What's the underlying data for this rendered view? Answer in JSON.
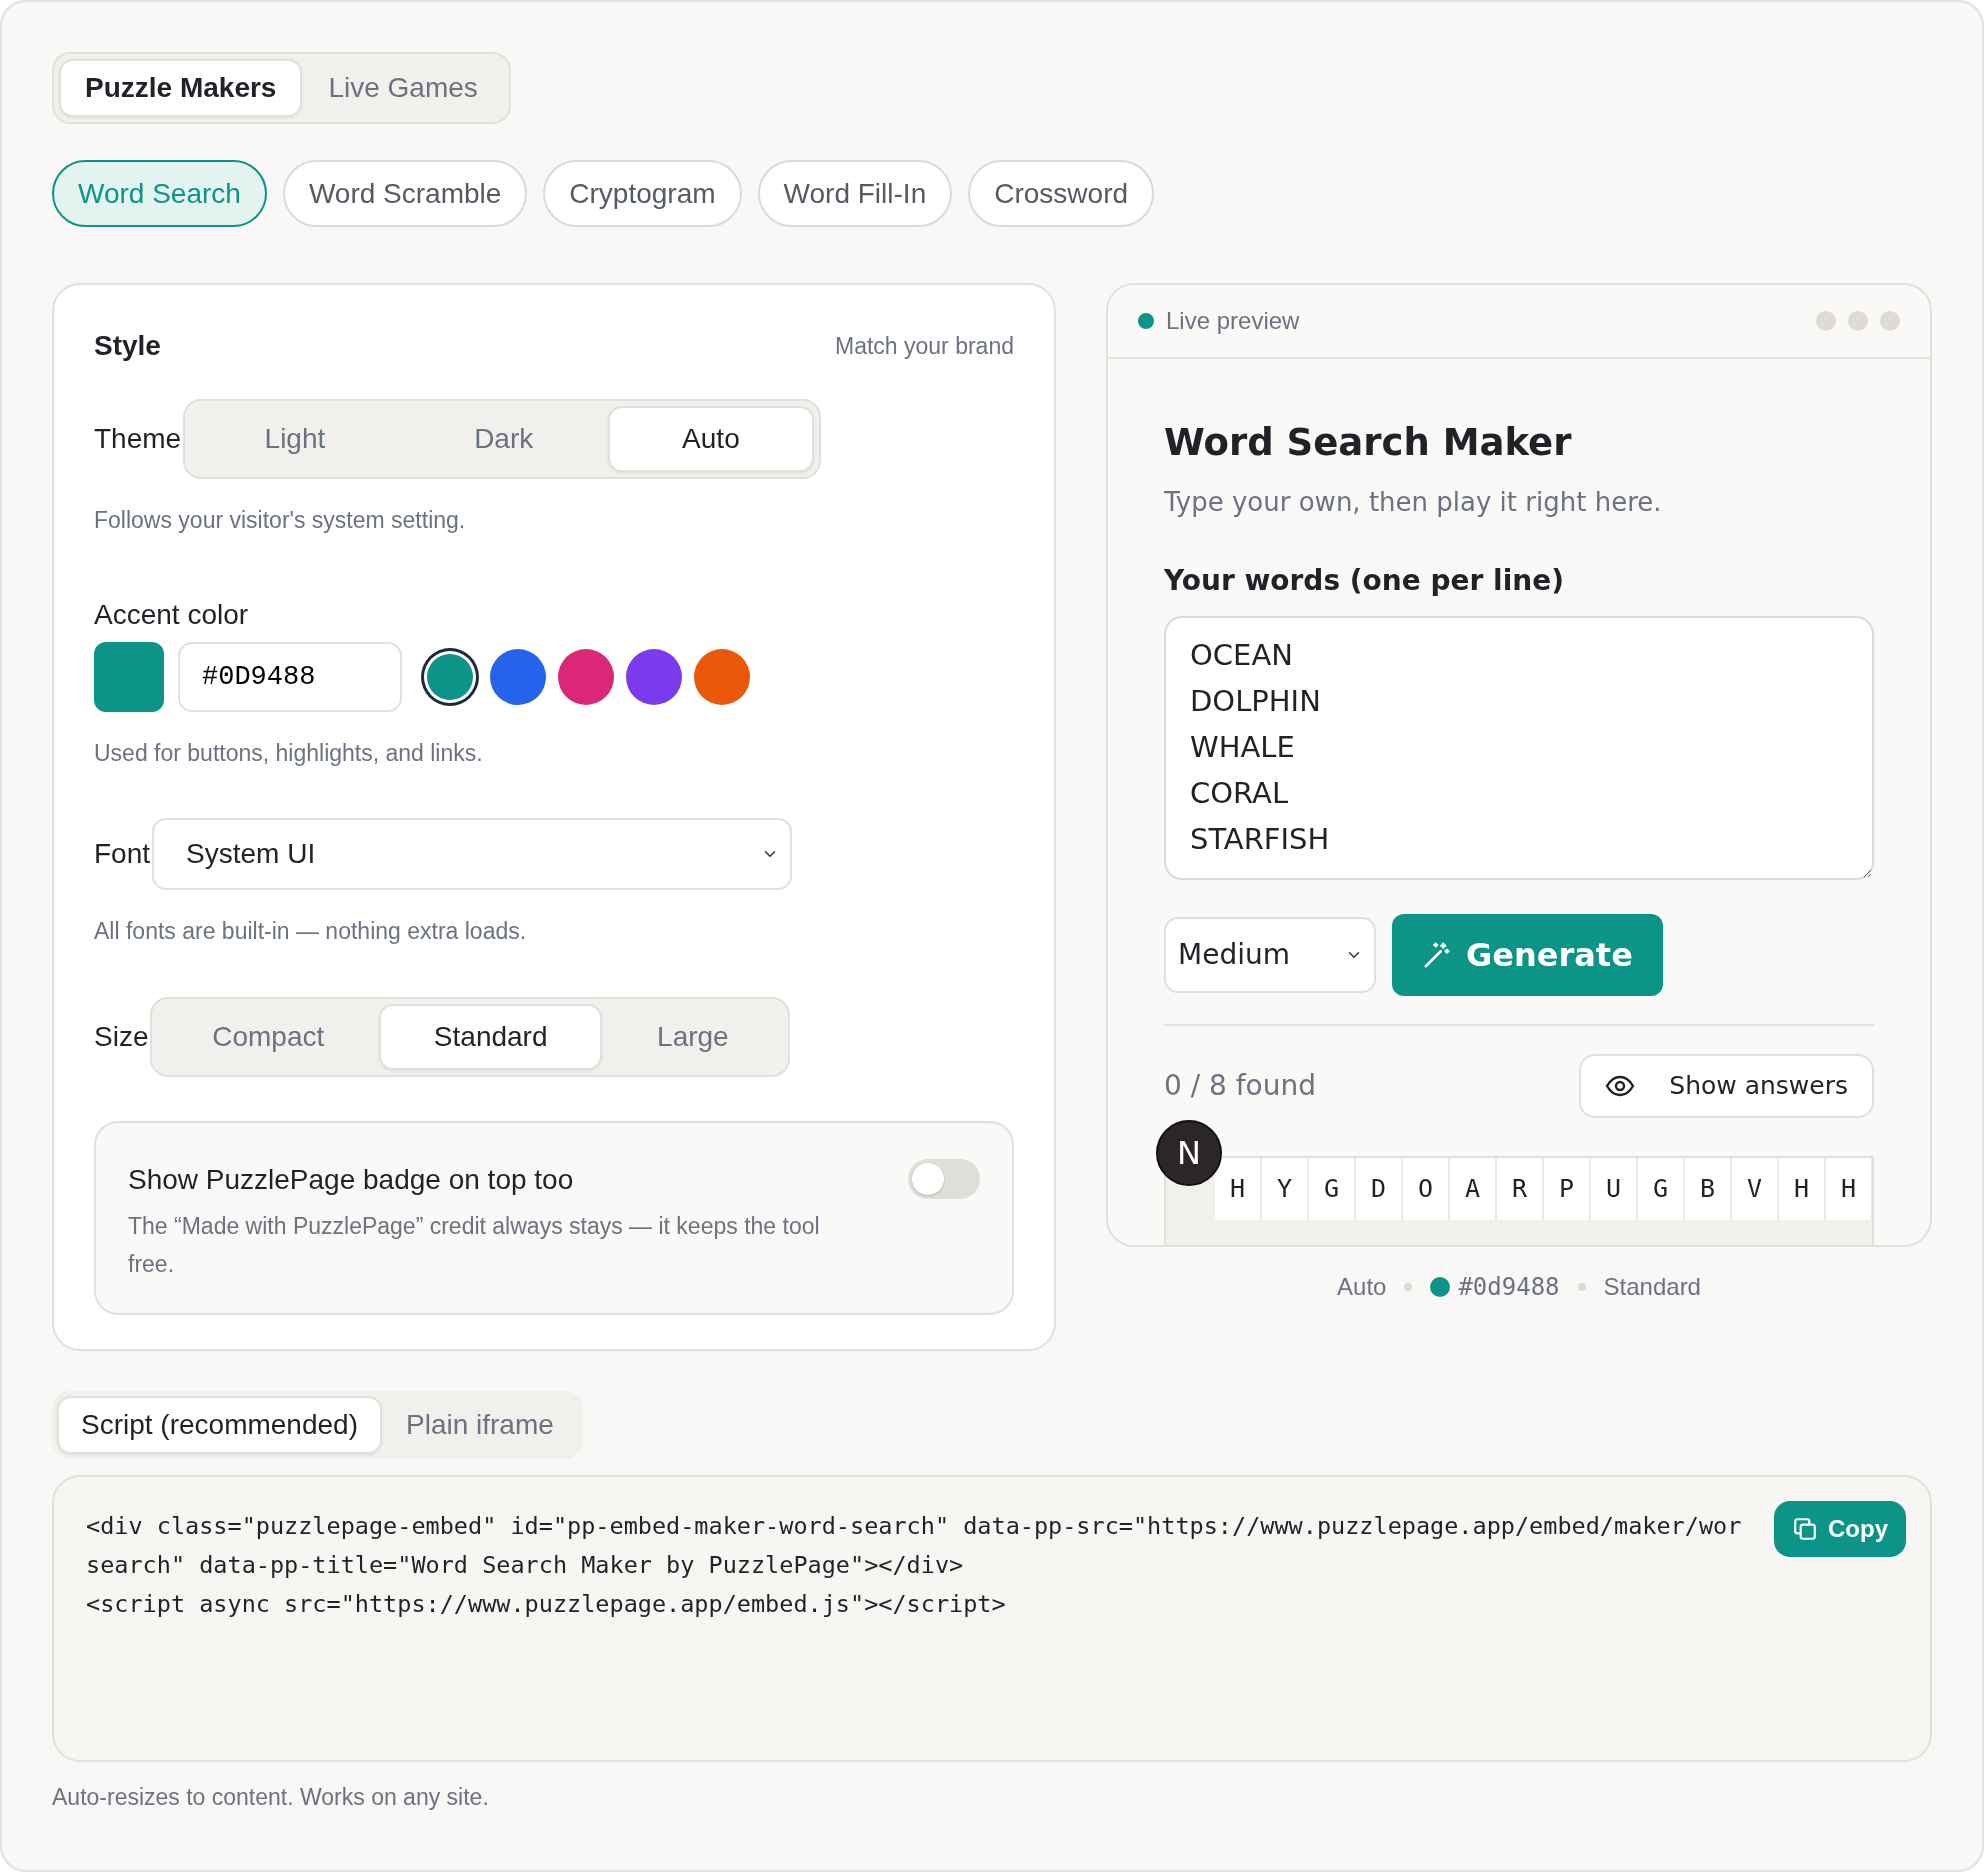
{
  "mode_tabs": [
    {
      "label": "Puzzle Makers",
      "selected": true
    },
    {
      "label": "Live Games",
      "selected": false
    }
  ],
  "puzzle_types": [
    {
      "label": "Word Search",
      "selected": true
    },
    {
      "label": "Word Scramble",
      "selected": false
    },
    {
      "label": "Cryptogram",
      "selected": false
    },
    {
      "label": "Word Fill-In",
      "selected": false
    },
    {
      "label": "Crossword",
      "selected": false
    }
  ],
  "style_panel": {
    "title": "Style",
    "hint": "Match your brand",
    "theme": {
      "label": "Theme",
      "options": [
        {
          "label": "Light",
          "selected": false
        },
        {
          "label": "Dark",
          "selected": false
        },
        {
          "label": "Auto",
          "selected": true
        }
      ],
      "help": "Follows your visitor's system setting."
    },
    "accent": {
      "label": "Accent color",
      "color": "#0d9488",
      "value": "#0D9488",
      "swatches": [
        {
          "color": "#0d9488",
          "selected": true
        },
        {
          "color": "#2563eb",
          "selected": false
        },
        {
          "color": "#db2777",
          "selected": false
        },
        {
          "color": "#7c3aed",
          "selected": false
        },
        {
          "color": "#ea580c",
          "selected": false
        }
      ],
      "help": "Used for buttons, highlights, and links."
    },
    "font": {
      "label": "Font",
      "value": "System UI",
      "help": "All fonts are built-in — nothing extra loads."
    },
    "size": {
      "label": "Size",
      "options": [
        {
          "label": "Compact",
          "selected": false
        },
        {
          "label": "Standard",
          "selected": true
        },
        {
          "label": "Large",
          "selected": false
        }
      ]
    },
    "badge_toggle": {
      "title": "Show PuzzlePage badge on top too",
      "description": "The “Made with PuzzlePage” credit always stays — it keeps the tool free.",
      "on": false
    }
  },
  "preview": {
    "header": "Live preview",
    "title": "Word Search Maker",
    "subtitle": "Type your own, then play it right here.",
    "words_label": "Your words (one per line)",
    "words": [
      "OCEAN",
      "DOLPHIN",
      "WHALE",
      "CORAL",
      "STARFISH"
    ],
    "difficulty": "Medium",
    "generate": "Generate",
    "found": "0 / 8 found",
    "show_answers": "Show answers",
    "avatar": "N",
    "grid_row": [
      "H",
      "Y",
      "G",
      "D",
      "O",
      "A",
      "R",
      "P",
      "U",
      "G",
      "B",
      "V",
      "H",
      "H"
    ]
  },
  "summary": [
    {
      "text": "Auto",
      "kind": "text"
    },
    {
      "text": "#0d9488",
      "kind": "color"
    },
    {
      "text": "Standard",
      "kind": "text"
    }
  ],
  "embed_tabs": [
    {
      "label": "Script (recommended)",
      "selected": true
    },
    {
      "label": "Plain iframe",
      "selected": false
    }
  ],
  "code_lines": [
    "<div class=\"puzzlepage-embed\" id=\"pp-embed-maker-word-search\" data-pp-src=\"https://www.puzzlepage.app/embed/maker/wor",
    "search\" data-pp-title=\"Word Search Maker by PuzzlePage\"></div>",
    "<script async src=\"https://www.puzzlepage.app/embed.js\"></script>"
  ],
  "copy": "Copy",
  "footer": "Auto-resizes to content. Works on any site."
}
